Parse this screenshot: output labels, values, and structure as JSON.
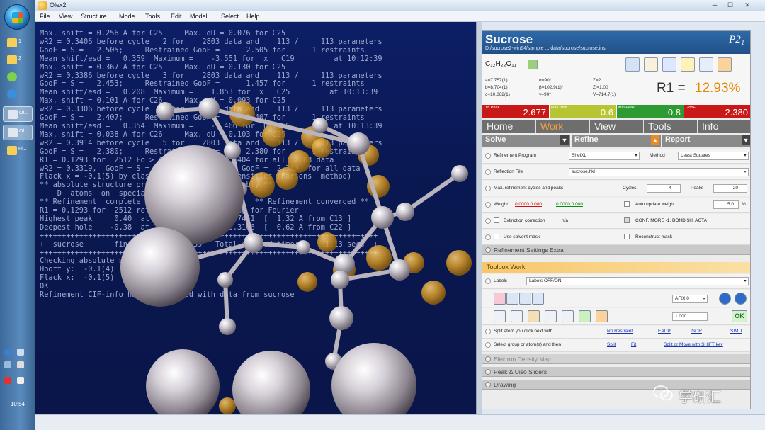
{
  "window": {
    "title": "Olex2",
    "controls": {
      "minimize": "─",
      "maximize": "☐",
      "close": "✕"
    }
  },
  "menu": [
    "File",
    "View",
    "Structure",
    "Mode",
    "Tools",
    "Edit",
    "Model",
    "Select",
    "Help"
  ],
  "taskbar": {
    "clock": "10:54",
    "items": [
      "1",
      "2",
      "",
      "",
      "Ol...",
      "Ol...",
      "Fi..."
    ]
  },
  "console": {
    "lines": [
      "Max. shift = 0.256 A for C25     Max. dU = 0.076 for C25",
      "wR2 = 0.3406 before cycle   2 for    2803 data and    113 /     113 parameters",
      "GooF = S =   2.505;     Restrained GooF =      2.505 for      1 restraints",
      "Mean shift/esd =   0.359  Maximum =    -3.551 for  x   C19         at 10:12:39",
      "Max. shift = 0.367 A for C25     Max. dU = 0.130 for C25",
      "wR2 = 0.3386 before cycle   3 for    2803 data and    113 /     113 parameters",
      "GooF = S =   2.453;     Restrained GooF =      1.457 for      1 restraints",
      "Mean shift/esd =   0.208  Maximum =    1.853 for  x   C25         at 10:13:39",
      "Max. shift = 0.101 A for C26     Max. dU = 0.093 for C25",
      "wR2 = 0.3306 before cycle   4 for    2803 data and    113 /     113 parameters",
      "GooF = S =   2.407;     Restrained GooF =      2.407 for      1 restraints",
      "Mean shift/esd =   0.354  Maximum =    -1.466 for  U11 C6          at 10:13:39",
      "Max. shift = 0.038 A for C26     Max. dU = 0.103 for C25",
      "wR2 = 0.3914 before cycle   5 for    2803 data and    113 /     113 parameters",
      "GooF = S =   2.380;     Restrained GooF =      2.380 for      1 restraints",
      "R1 = 0.1293 for  2512 Fo > 4sig(Fo)  and  0.1404 for all  2803 data",
      "wR2 = 0.3319,  GooF = S =  2.380,  Restrained GooF =  2.380  for all data",
      "Flack x = -0.1(5) by classical fit to all intensities (Parsons' method)",
      "** absolute structure probably determined reliably **",
      "    D  atoms  on  special positions shows NPD",
      "",
      "** Refinement  complete  (AFIX)  **              ** Refinement converged **",
      "",
      "R1 = 0.1293 for  2512 reflections after merging for Fourier",
      "Highest peak     0.40  at  0.2235  0.6160  0.7451  [  1.32 A from C13 ]",
      "Deepest hole    -0.38  at  0.0100  0.5145  0.3166  [  0.62 A from C22 ]",
      "",
      "+++++++++++++++++++++++++++++++++++++++++++++++++++++++++++++++++++++++++++++",
      "+  sucrose       finished at 10:13:39   Total elapsed time:      1.13 secs  +",
      "+++++++++++++++++++++++++++++++++++++++++++++++++++++++++++++++++++++++++++++",
      "Checking absolute structure...",
      "Hooft y:  -0.1(4)",
      "Flack x:  -0.1(5)",
      "OK",
      "Refinement CIF-info has been loaded with data from sucrose"
    ],
    "prompt": ">>"
  },
  "panel": {
    "structure_name": "Sucrose",
    "path": "D:/sucrose2-win64/sample ... data/sucrose/sucrose.ins",
    "space_group": "P2₁",
    "formula": "C₁₂H₂₂O₁₁",
    "cell_lines": [
      "a=7.757(1)",
      "b=8.704(1)",
      "c=10.862(1)",
      "α=90°",
      "β=102.9(1)°",
      "γ=90°",
      "Z=2",
      "Z'=1.00",
      "V=714.7(1)"
    ],
    "r1_label": "R1 =",
    "r1_value": "12.93%",
    "stats": [
      {
        "label": "Diff Peak",
        "value": "2.677",
        "color": "#c81818"
      },
      {
        "label": "Max Shift",
        "value": "0.6",
        "color": "#b7c533"
      },
      {
        "label": "Min Peak",
        "value": "-0.8",
        "color": "#2e9a32"
      },
      {
        "label": "GooF",
        "value": "2.380",
        "color": "#c81818"
      }
    ],
    "main_tabs": [
      "Home",
      "Work",
      "View",
      "Tools",
      "Info"
    ],
    "active_main_tab": "Work",
    "sub_tabs": [
      "Solve",
      "Refine",
      "Report"
    ],
    "refine": {
      "program_label": "Refinement Program",
      "program_value": "ShelXL",
      "method_label": "Method",
      "method_value": "Least Squares",
      "reflection_label": "Reflection File",
      "reflection_value": "sucrose.hkl",
      "cycles_label": "Max. refinement cycles and peaks",
      "cycles_sub_label": "Cycles",
      "cycles_value": "4",
      "peaks_sub_label": "Peaks",
      "peaks_value": "20",
      "weight_label": "Weight",
      "weight_current": "0.0000 0.000",
      "weight_suggested": "0.0000 0.000",
      "auto_update_label": "Auto update weight",
      "auto_update_value": "5.0",
      "auto_update_unit": "%",
      "extinction_label": "Extinction correction",
      "extinction_value": "n/a",
      "conf_label": "CONF, MORE -1, BOND $H, ACTA",
      "solvent_label": "Use solvent mask",
      "reconstruct_label": "Reconstruct mask",
      "settings_extra": "Refinement Settings Extra"
    },
    "toolbox": {
      "title": "Toolbox Work",
      "labels_label": "Labels",
      "labels_value": "Labels OFF/ON",
      "mode_value": "AFIX 0",
      "thresh_value": "1.000",
      "ok_label": "OK",
      "split_label": "Split atom you click next with",
      "split_links": [
        "No Restraint",
        "EADP",
        "ISOR",
        "SIMU"
      ],
      "select_label": "Select group or atom(s) and then",
      "select_links": [
        "Split",
        "Fit"
      ],
      "select_hint": "Split or Move with SHIFT key",
      "sections": [
        "Electron Density Map",
        "Peak & Uiso Sliders",
        "Drawing"
      ]
    }
  },
  "watermark": "学研汇",
  "colors": {
    "panel_header": "#215087",
    "active_tab": "#f0a040",
    "toolbox_header": "#f7c76a",
    "viewport_bg": "#0c1e66"
  }
}
